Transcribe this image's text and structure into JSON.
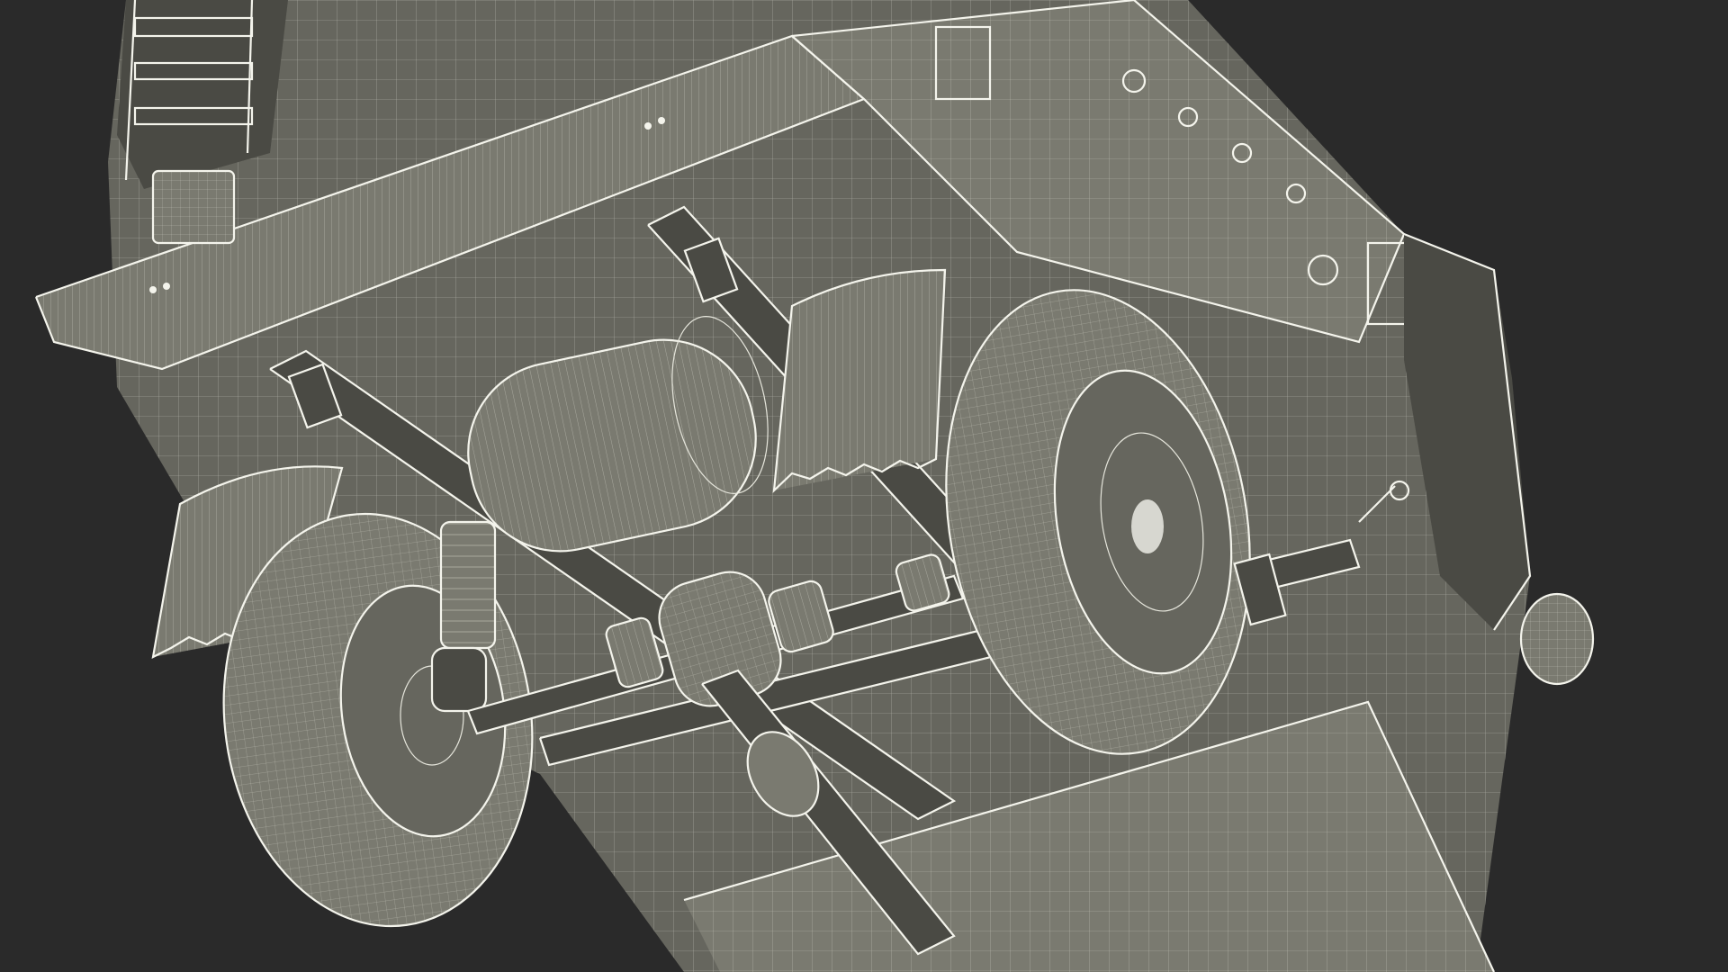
{
  "scene": {
    "subject": "wireframe-vehicle-underside",
    "colors": {
      "background": "#2a2a2a",
      "surface": "#66665e",
      "surface_dark": "#4a4a44",
      "surface_light": "#7a7a70",
      "wire": "#e6e6dc",
      "edge": "#f4f4ec"
    },
    "icons": [
      "wheel-icon",
      "tank-icon",
      "spring-icon",
      "mudflap-icon",
      "axle-icon"
    ]
  }
}
